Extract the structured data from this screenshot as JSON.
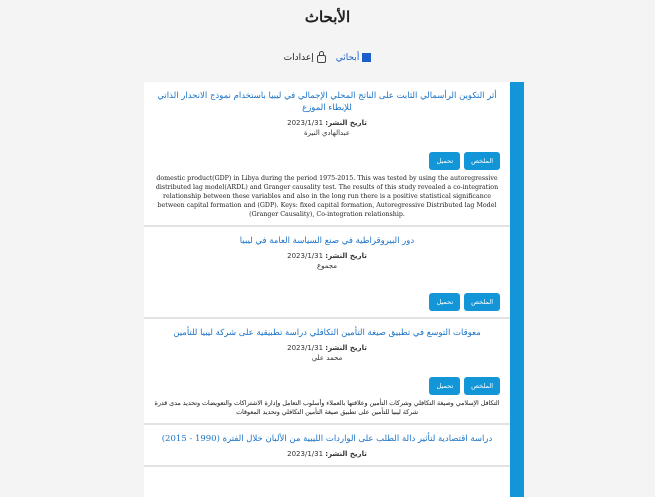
{
  "page": {
    "title": "الأبحاث"
  },
  "tabs": [
    {
      "label": "أبحاثي",
      "icon": "document-icon",
      "active": true
    },
    {
      "label": "إعدادات",
      "icon": "lock-icon",
      "active": false
    }
  ],
  "theme": {
    "accent": "#1396d8",
    "link": "#1a73c6"
  },
  "items": [
    {
      "title": "أثر التكوين الرأسمالي الثابت على الناتج المحلي الإجمالي في ليبيا باستخدام نموذج الانحدار الذاتي للإبطاء الموزع",
      "date_label": "تاريخ النشر:",
      "date": "2023/1/31",
      "author": "عبدالهادي النيرة",
      "btn_primary": "الملخص",
      "btn_secondary": "تحميل",
      "abstract": "domestic product(GDP) in Libya during the period 1975-2015. This was tested by using the autoregressive distributed lag model(ARDL) and Granger causality test. The results of this study revealed a co-integration relationship between these variables and also in the long run there is a positive statistical significance between capital formation and (GDP). Keys: fixed capital formation, Autoregressive Distributed lag Model (Granger Causality), Co-integration relationship."
    },
    {
      "title": "دور البيروقراطية في صنع السياسة العامة في ليبيا",
      "date_label": "تاريخ النشر:",
      "date": "2023/1/31",
      "author": "مجموع",
      "btn_primary": "الملخص",
      "btn_secondary": "تحميل",
      "abstract": ""
    },
    {
      "title": "معوقات التوسع في تطبيق صيغة التأمين التكافلي دراسة تطبيقية على شركة ليبيا للتأمين",
      "date_label": "تاريخ النشر:",
      "date": "2023/1/31",
      "author": "محمد علي",
      "btn_primary": "الملخص",
      "btn_secondary": "تحميل",
      "abstract": "التكافل الإسلامي وصيغة التكافلي وشركات التأمين وعلاقتها بالعملاء وأسلوب التعامل وإدارة الاشتراكات والتعويضات وتحديد مدى قدرة شركة ليبيا للتأمين على تطبيق صيغة التأمين التكافلي وتحديد المعوقات"
    },
    {
      "title": "دراسة اقتصادية لتأثير دالة الطلب على الواردات الليبية من الألبان خلال الفترة (1990 - 2015)",
      "date_label": "تاريخ النشر:",
      "date": "2023/1/31",
      "author": "",
      "btn_primary": "الملخص",
      "btn_secondary": "تحميل",
      "abstract": ""
    }
  ]
}
